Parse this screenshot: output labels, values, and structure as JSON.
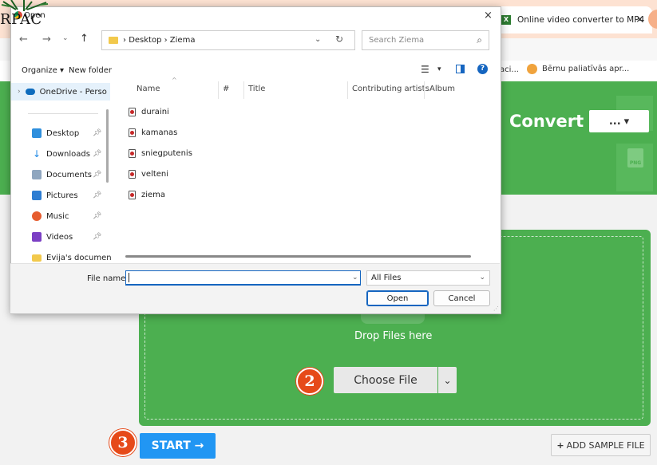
{
  "browser": {
    "tab_title": "Online video converter to MP4",
    "tab_close": "×",
    "bookmarks": [
      "aci...",
      "Bērnu paliatīvās apr..."
    ]
  },
  "page": {
    "convert_label": "Convert",
    "convert_dropdown": "...",
    "drop_text": "Drop Files here",
    "choose_file": "Choose File",
    "start_button": "START →",
    "add_sample_button": "ADD SAMPLE FILE",
    "step_badges": [
      "2",
      "3"
    ]
  },
  "dialog": {
    "title": "Open",
    "close": "×",
    "breadcrumb": [
      "Desktop",
      "Ziema"
    ],
    "search_placeholder": "Search Ziema",
    "organize": "Organize ▾",
    "new_folder": "New folder",
    "nav_items": [
      {
        "label": "OneDrive - Perso",
        "icon": "onedrive-icon"
      },
      {
        "label": "Desktop",
        "icon": "desktop-icon"
      },
      {
        "label": "Downloads",
        "icon": "download-icon"
      },
      {
        "label": "Documents",
        "icon": "documents-icon"
      },
      {
        "label": "Pictures",
        "icon": "pictures-icon"
      },
      {
        "label": "Music",
        "icon": "music-icon"
      },
      {
        "label": "Videos",
        "icon": "videos-icon"
      },
      {
        "label": "Evija's documen",
        "icon": "folder-icon"
      }
    ],
    "columns": [
      "Name",
      "#",
      "Title",
      "Contributing artists",
      "Album"
    ],
    "files": [
      "duraini",
      "kamanas",
      "sniegputenis",
      "velteni",
      "ziema"
    ],
    "file_name_label": "File name:",
    "file_name_value": "",
    "file_type": "All Files",
    "open_button": "Open",
    "cancel_button": "Cancel"
  },
  "logo": {
    "text": "RPAC"
  },
  "colors": {
    "green": "#4caf50",
    "start_blue": "#2196f3",
    "badge": "#e64a19",
    "dialog_accent": "#1565c0"
  }
}
